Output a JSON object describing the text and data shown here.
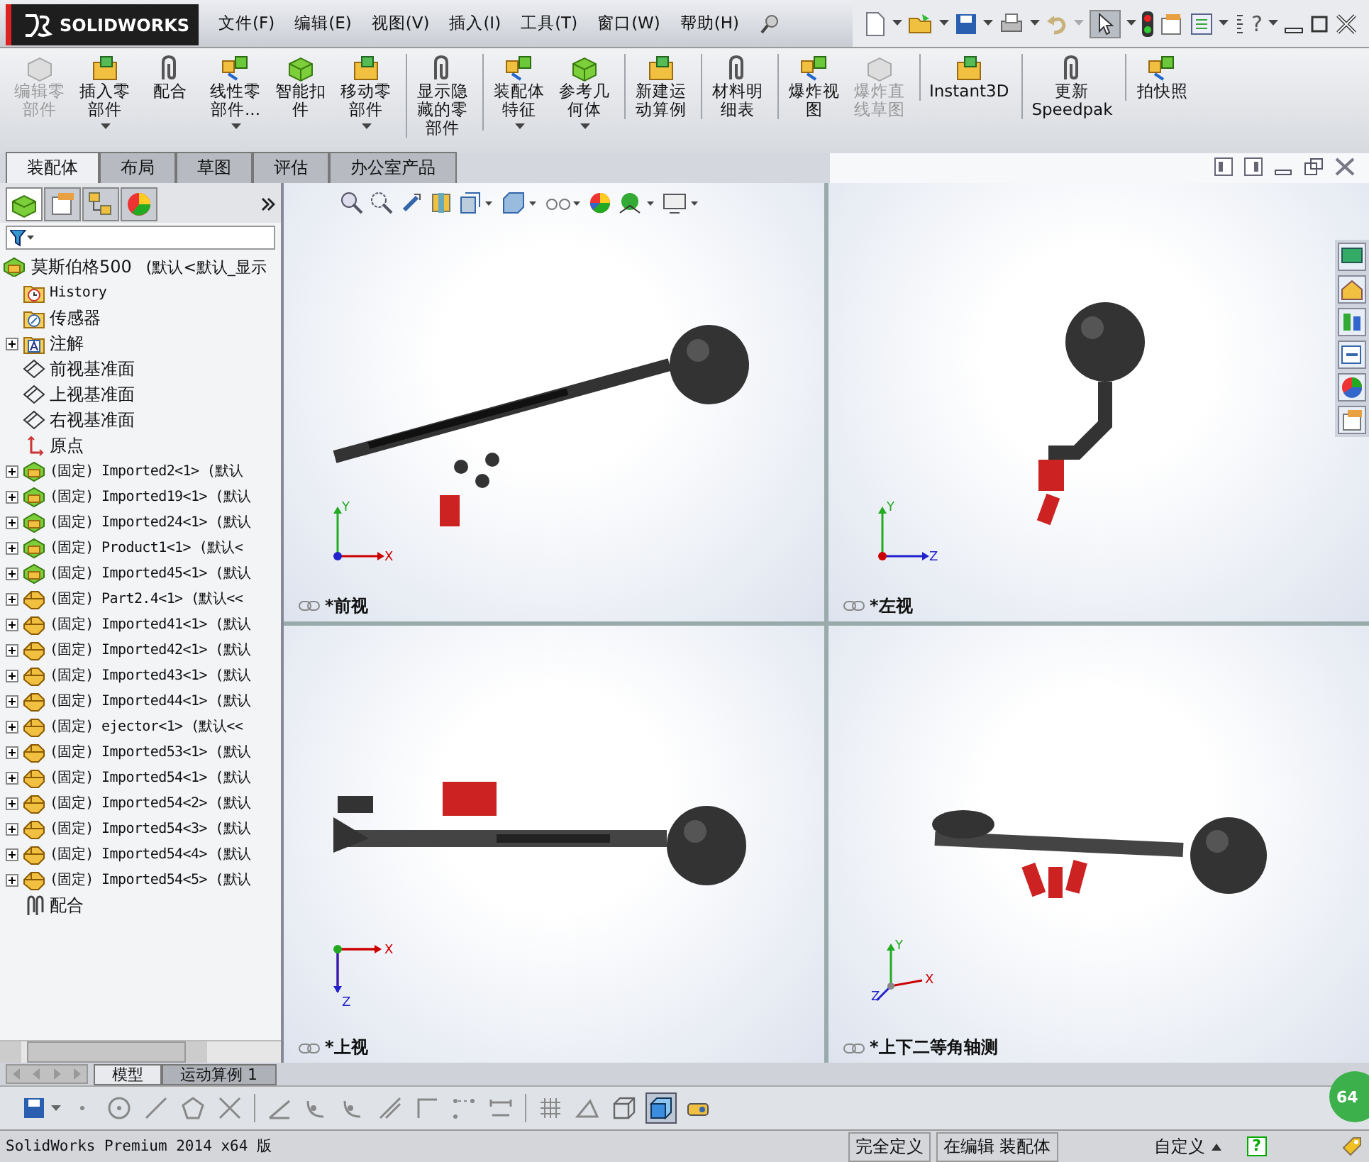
{
  "app": {
    "logo": "SOLIDWORKS"
  },
  "menu": [
    "文件(F)",
    "编辑(E)",
    "视图(V)",
    "插入(I)",
    "工具(T)",
    "窗口(W)",
    "帮助(H)"
  ],
  "quick_toolbar": {
    "help": "?"
  },
  "ribbon": [
    {
      "lines": [
        "编辑零",
        "部件"
      ],
      "disabled": true,
      "dropdown": false,
      "group_start": false
    },
    {
      "lines": [
        "插入零",
        "部件"
      ],
      "disabled": false,
      "dropdown": true,
      "group_start": false
    },
    {
      "lines": [
        "配合"
      ],
      "disabled": false,
      "dropdown": false,
      "group_start": false
    },
    {
      "lines": [
        "线性零",
        "部件..."
      ],
      "disabled": false,
      "dropdown": true,
      "group_start": false
    },
    {
      "lines": [
        "智能扣",
        "件"
      ],
      "disabled": false,
      "dropdown": false,
      "group_start": false
    },
    {
      "lines": [
        "移动零",
        "部件"
      ],
      "disabled": false,
      "dropdown": true,
      "group_start": false
    },
    {
      "lines": [
        "显示隐",
        "藏的零",
        "部件"
      ],
      "disabled": false,
      "dropdown": false,
      "group_start": true
    },
    {
      "lines": [
        "装配体",
        "特征"
      ],
      "disabled": false,
      "dropdown": true,
      "group_start": true
    },
    {
      "lines": [
        "参考几",
        "何体"
      ],
      "disabled": false,
      "dropdown": true,
      "group_start": false
    },
    {
      "lines": [
        "新建运",
        "动算例"
      ],
      "disabled": false,
      "dropdown": false,
      "group_start": true
    },
    {
      "lines": [
        "材料明",
        "细表"
      ],
      "disabled": false,
      "dropdown": false,
      "group_start": true
    },
    {
      "lines": [
        "爆炸视",
        "图"
      ],
      "disabled": false,
      "dropdown": false,
      "group_start": true
    },
    {
      "lines": [
        "爆炸直",
        "线草图"
      ],
      "disabled": true,
      "dropdown": false,
      "group_start": false
    },
    {
      "lines": [
        "Instant3D"
      ],
      "disabled": false,
      "dropdown": false,
      "group_start": true
    },
    {
      "lines": [
        "更新",
        "Speedpak"
      ],
      "disabled": false,
      "dropdown": false,
      "group_start": true
    },
    {
      "lines": [
        "拍快照"
      ],
      "disabled": false,
      "dropdown": false,
      "group_start": true
    }
  ],
  "tabs": [
    {
      "label": "装配体",
      "selected": true
    },
    {
      "label": "布局",
      "selected": false
    },
    {
      "label": "草图",
      "selected": false
    },
    {
      "label": "评估",
      "selected": false
    },
    {
      "label": "办公室产品",
      "selected": false
    }
  ],
  "tree": {
    "label": "莫斯伯格500",
    "note": "(默认<默认_显示",
    "children": [
      {
        "kind": "history",
        "label": "History",
        "expandable": false
      },
      {
        "kind": "sensor",
        "label": "传感器",
        "expandable": false
      },
      {
        "kind": "annotation",
        "label": "注解",
        "expandable": true
      },
      {
        "kind": "plane",
        "label": "前视基准面",
        "expandable": false
      },
      {
        "kind": "plane",
        "label": "上视基准面",
        "expandable": false
      },
      {
        "kind": "plane",
        "label": "右视基准面",
        "expandable": false
      },
      {
        "kind": "origin",
        "label": "原点",
        "expandable": false
      },
      {
        "kind": "assembly",
        "label": "(固定) Imported2<1> (默认",
        "expandable": true
      },
      {
        "kind": "assembly",
        "label": "(固定) Imported19<1> (默认",
        "expandable": true
      },
      {
        "kind": "assembly",
        "label": "(固定) Imported24<1> (默认",
        "expandable": true
      },
      {
        "kind": "assembly",
        "label": "(固定) Product1<1> (默认<",
        "expandable": true
      },
      {
        "kind": "assembly",
        "label": "(固定) Imported45<1> (默认",
        "expandable": true
      },
      {
        "kind": "part",
        "label": "(固定) Part2.4<1> (默认<<",
        "expandable": true
      },
      {
        "kind": "part",
        "label": "(固定) Imported41<1> (默认",
        "expandable": true
      },
      {
        "kind": "part",
        "label": "(固定) Imported42<1> (默认",
        "expandable": true
      },
      {
        "kind": "part",
        "label": "(固定) Imported43<1> (默认",
        "expandable": true
      },
      {
        "kind": "part",
        "label": "(固定) Imported44<1> (默认",
        "expandable": true
      },
      {
        "kind": "part",
        "label": "(固定) ejector<1> (默认<<",
        "expandable": true
      },
      {
        "kind": "part",
        "label": "(固定) Imported53<1> (默认",
        "expandable": true
      },
      {
        "kind": "part",
        "label": "(固定) Imported54<1> (默认",
        "expandable": true
      },
      {
        "kind": "part",
        "label": "(固定) Imported54<2> (默认",
        "expandable": true
      },
      {
        "kind": "part",
        "label": "(固定) Imported54<3> (默认",
        "expandable": true
      },
      {
        "kind": "part",
        "label": "(固定) Imported54<4> (默认",
        "expandable": true
      },
      {
        "kind": "part",
        "label": "(固定) Imported54<5> (默认",
        "expandable": true
      },
      {
        "kind": "mate",
        "label": "配合",
        "expandable": false
      }
    ]
  },
  "viewports": [
    {
      "label": "*前视",
      "axes": [
        "Y",
        "X"
      ]
    },
    {
      "label": "*左视",
      "axes": [
        "Y",
        "Z"
      ]
    },
    {
      "label": "*上视",
      "axes": [
        "X",
        "Z"
      ]
    },
    {
      "label": "*上下二等角轴测",
      "axes": [
        "Y",
        "X",
        "Z"
      ]
    }
  ],
  "bottom_tabs": [
    {
      "label": "模型",
      "selected": true
    },
    {
      "label": "运动算例 1",
      "selected": false
    }
  ],
  "badge": "64",
  "status_bar": {
    "product": "SolidWorks Premium 2014 x64 版",
    "state": "完全定义",
    "mode": "在编辑 装配体",
    "units": "自定义",
    "help": "?"
  }
}
